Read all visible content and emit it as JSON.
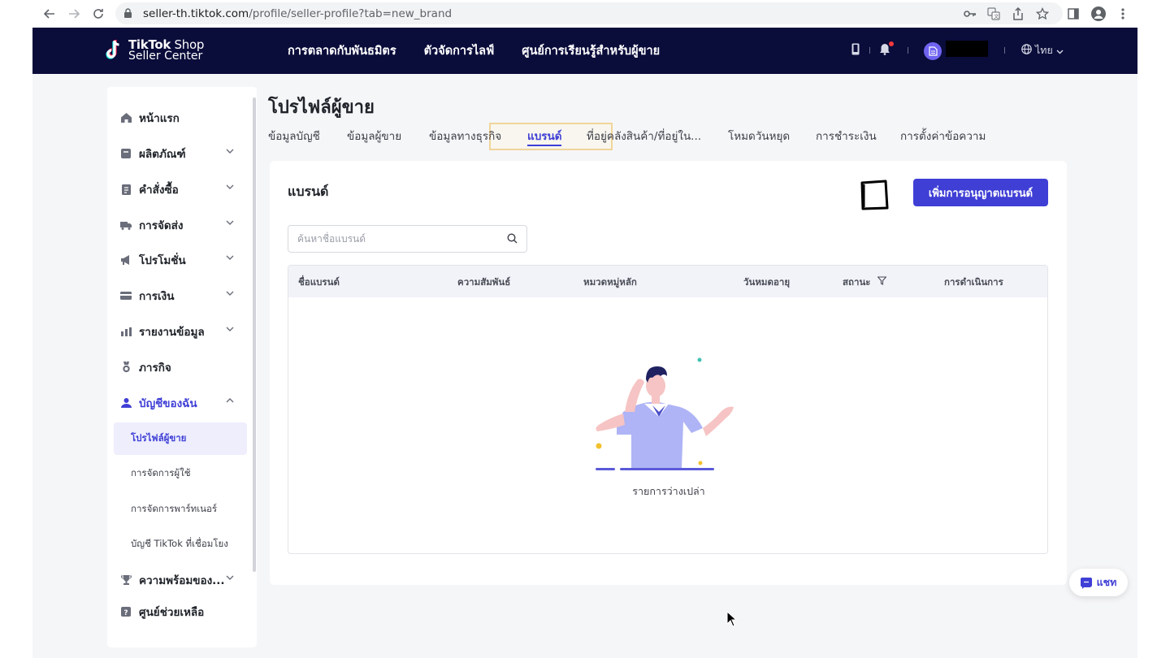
{
  "browser": {
    "url_host": "seller-th.tiktok.com",
    "url_path": "/profile/seller-profile?tab=new_brand"
  },
  "header": {
    "logo_line1_bold": "TikTok",
    "logo_line1_light": " Shop",
    "logo_line2": "Seller Center",
    "nav": [
      "การตลาดกับพันธมิตร",
      "ตัวจัดการไลฟ์",
      "ศูนย์การเรียนรู้สำหรับผู้ขาย"
    ],
    "language": "ไทย"
  },
  "sidebar": {
    "items": [
      {
        "label": "หน้าแรก",
        "icon": "home-icon"
      },
      {
        "label": "ผลิตภัณฑ์",
        "icon": "product-icon"
      },
      {
        "label": "คำสั่งซื้อ",
        "icon": "order-icon"
      },
      {
        "label": "การจัดส่ง",
        "icon": "truck-icon"
      },
      {
        "label": "โปรโมชั่น",
        "icon": "megaphone-icon"
      },
      {
        "label": "การเงิน",
        "icon": "card-icon"
      },
      {
        "label": "รายงานข้อมูล",
        "icon": "chart-icon"
      },
      {
        "label": "ภารกิจ",
        "icon": "medal-icon"
      },
      {
        "label": "บัญชีของฉัน",
        "icon": "user-icon"
      },
      {
        "label": "ความพร้อมของ...",
        "icon": "trophy-icon"
      },
      {
        "label": "ศูนย์ช่วยเหลือ",
        "icon": "help-icon"
      }
    ],
    "sub_items": [
      "โปรไฟล์ผู้ขาย",
      "การจัดการผู้ใช้",
      "การจัดการพาร์ทเนอร์",
      "บัญชี TikTok ที่เชื่อมโยง"
    ]
  },
  "main": {
    "title": "โปรไฟล์ผู้ขาย",
    "tabs": [
      "ข้อมูลบัญชี",
      "ข้อมูลผู้ขาย",
      "ข้อมูลทางธุรกิจ",
      "แบรนด์",
      "ที่อยู่คลังสินค้า/ที่อยู่ใน...",
      "โหมดวันหยุด",
      "การชำระเงิน",
      "การตั้งค่าข้อความ"
    ],
    "active_tab": "แบรนด์",
    "card_title": "แบรนด์",
    "add_button": "เพิ่มการอนุญาตแบรนด์",
    "search_placeholder": "ค้นหาชื่อแบรนด์",
    "columns": [
      "ชื่อแบรนด์",
      "ความสัมพันธ์",
      "หมวดหมู่หลัก",
      "วันหมดอายุ",
      "สถานะ",
      "การดำเนินการ"
    ],
    "empty_text": "รายการว่างเปล่า"
  },
  "chat": {
    "label": "แชท"
  },
  "colors": {
    "header_bg": "#0a0c3a",
    "accent": "#3f3fd6",
    "page_bg": "#f5f6f8"
  }
}
